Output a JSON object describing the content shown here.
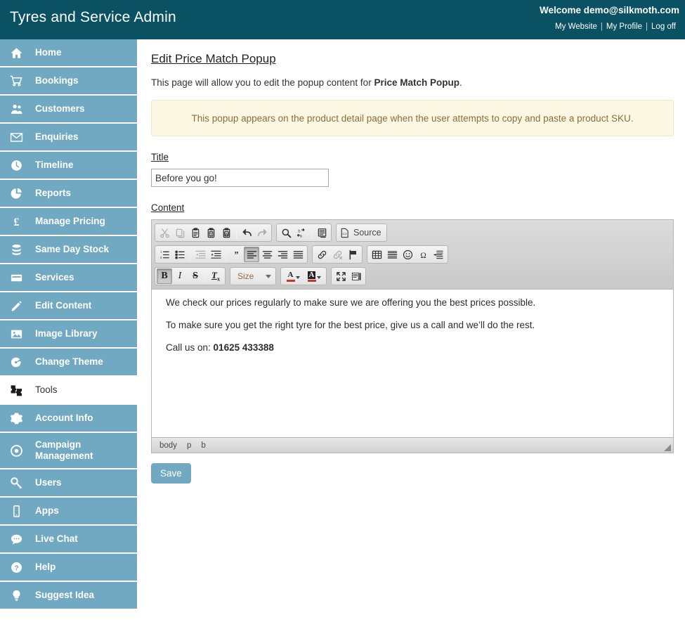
{
  "header": {
    "brand": "Tyres and Service Admin",
    "welcome": "Welcome demo@silkmoth.com",
    "links": [
      {
        "label": "My Website",
        "icon": "external-link-icon"
      },
      {
        "label": "My Profile",
        "icon": "user-icon"
      },
      {
        "label": "Log off",
        "icon": "logout-icon"
      }
    ],
    "separator": "|",
    "bg_color": "#0a5263"
  },
  "sidebar": {
    "bg_color": "#70a9c1",
    "active_item": "Tools",
    "items": [
      {
        "label": "Home",
        "icon": "home-icon",
        "active": false
      },
      {
        "label": "Bookings",
        "icon": "shopping-cart-icon",
        "active": false
      },
      {
        "label": "Customers",
        "icon": "users-icon",
        "active": false
      },
      {
        "label": "Enquiries",
        "icon": "envelope-icon",
        "active": false
      },
      {
        "label": "Timeline",
        "icon": "clock-icon",
        "active": false
      },
      {
        "label": "Reports",
        "icon": "pie-chart-icon",
        "active": false
      },
      {
        "label": "Manage Pricing",
        "icon": "pound-sterling-icon",
        "active": false
      },
      {
        "label": "Same Day Stock",
        "icon": "database-icon",
        "active": false
      },
      {
        "label": "Services",
        "icon": "credit-card-icon",
        "active": false
      },
      {
        "label": "Edit Content",
        "icon": "pencil-icon",
        "active": false
      },
      {
        "label": "Image Library",
        "icon": "image-icon",
        "active": false
      },
      {
        "label": "Change Theme",
        "icon": "paint-roller-icon",
        "active": false
      },
      {
        "label": "Tools",
        "icon": "puzzle-tools-icon",
        "active": true
      },
      {
        "label": "Account Info",
        "icon": "gear-icon",
        "active": false
      },
      {
        "label": "Campaign Management",
        "icon": "target-icon",
        "active": false
      },
      {
        "label": "Users",
        "icon": "key-icon",
        "active": false
      },
      {
        "label": "Apps",
        "icon": "mobile-icon",
        "active": false
      },
      {
        "label": "Live Chat",
        "icon": "chat-bubble-icon",
        "active": false
      },
      {
        "label": "Help",
        "icon": "question-circle-icon",
        "active": false
      },
      {
        "label": "Suggest Idea",
        "icon": "lightbulb-icon",
        "active": false
      }
    ]
  },
  "main": {
    "page_title": "Edit Price Match Popup",
    "intro_prefix": "This page will allow you to edit the popup content for ",
    "intro_bold": "Price Match Popup",
    "intro_suffix": ".",
    "notice": "This popup appears on the product detail page when the user attempts to copy and paste a product SKU.",
    "notice_bg_color": "#fcf8e3",
    "notice_text_color": "#8a6d3b",
    "title_label": "Title",
    "title_value": "Before you go!",
    "title_placeholder": "",
    "content_label": "Content",
    "save_label": "Save",
    "save_color": "#70a9c1"
  },
  "editor": {
    "toolbar_rows": [
      {
        "groups": [
          {
            "buttons": [
              {
                "name": "cut-icon",
                "title": "Cut",
                "disabled": true
              },
              {
                "name": "copy-icon",
                "title": "Copy",
                "disabled": true
              },
              {
                "name": "paste-icon",
                "title": "Paste",
                "disabled": false
              },
              {
                "name": "paste-as-text-icon",
                "title": "Paste as plain text",
                "disabled": false
              },
              {
                "name": "paste-from-word-icon",
                "title": "Paste from Word",
                "disabled": false
              },
              {
                "name": "separator",
                "title": "",
                "disabled": false
              },
              {
                "name": "undo-icon",
                "title": "Undo",
                "disabled": false
              },
              {
                "name": "redo-icon",
                "title": "Redo",
                "disabled": true
              }
            ]
          },
          {
            "buttons": [
              {
                "name": "find-icon",
                "title": "Find",
                "disabled": false
              },
              {
                "name": "replace-icon",
                "title": "Replace",
                "disabled": false
              },
              {
                "name": "separator",
                "title": "",
                "disabled": false
              },
              {
                "name": "select-all-icon",
                "title": "Select All",
                "disabled": false
              }
            ]
          }
        ],
        "source_button": {
          "name": "source-icon",
          "label": "Source"
        }
      },
      {
        "groups": [
          {
            "buttons": [
              {
                "name": "numbered-list-icon",
                "title": "Insert/Remove Numbered List",
                "disabled": false
              },
              {
                "name": "bulleted-list-icon",
                "title": "Insert/Remove Bulleted List",
                "disabled": false
              },
              {
                "name": "separator",
                "title": "",
                "disabled": false
              },
              {
                "name": "outdent-icon",
                "title": "Decrease Indent",
                "disabled": true
              },
              {
                "name": "indent-icon",
                "title": "Increase Indent",
                "disabled": false
              },
              {
                "name": "separator",
                "title": "",
                "disabled": false
              },
              {
                "name": "blockquote-icon",
                "title": "Block Quote",
                "disabled": false
              },
              {
                "name": "align-left-icon",
                "title": "Align Left",
                "disabled": false,
                "active": true
              },
              {
                "name": "align-center-icon",
                "title": "Center",
                "disabled": false
              },
              {
                "name": "align-right-icon",
                "title": "Align Right",
                "disabled": false
              },
              {
                "name": "align-justify-icon",
                "title": "Justify",
                "disabled": false
              }
            ]
          },
          {
            "buttons": [
              {
                "name": "link-icon",
                "title": "Link",
                "disabled": false
              },
              {
                "name": "unlink-icon",
                "title": "Unlink",
                "disabled": true
              },
              {
                "name": "anchor-flag-icon",
                "title": "Anchor",
                "disabled": false
              }
            ]
          },
          {
            "buttons": [
              {
                "name": "table-icon",
                "title": "Table",
                "disabled": false
              },
              {
                "name": "horizontal-rule-icon",
                "title": "Horizontal Line",
                "disabled": false
              },
              {
                "name": "smiley-icon",
                "title": "Smiley",
                "disabled": false
              },
              {
                "name": "special-char-icon",
                "title": "Insert Special Character",
                "disabled": false
              },
              {
                "name": "page-break-icon",
                "title": "Page Break",
                "disabled": false
              }
            ]
          }
        ]
      },
      {
        "groups": [
          {
            "buttons": [
              {
                "name": "bold-icon",
                "title": "Bold",
                "disabled": false,
                "active": true
              },
              {
                "name": "italic-icon",
                "title": "Italic",
                "disabled": false
              },
              {
                "name": "strikethrough-icon",
                "title": "Strikethrough",
                "disabled": false
              },
              {
                "name": "separator",
                "title": "",
                "disabled": false
              },
              {
                "name": "remove-format-icon",
                "title": "Remove Format",
                "disabled": false
              }
            ]
          },
          {
            "combo": {
              "name": "font-size-combo",
              "label": "Size"
            }
          },
          {
            "buttons": [
              {
                "name": "text-color-icon",
                "title": "Text Color",
                "disabled": false
              },
              {
                "name": "background-color-icon",
                "title": "Background Color",
                "disabled": false
              }
            ]
          },
          {
            "buttons": [
              {
                "name": "maximize-icon",
                "title": "Maximize",
                "disabled": false
              },
              {
                "name": "show-blocks-icon",
                "title": "Show Blocks",
                "disabled": false
              }
            ]
          }
        ]
      }
    ],
    "content_paragraphs": [
      {
        "text": "We check our prices regularly to make sure we are offering you the best prices possible.",
        "bold_tail": ""
      },
      {
        "text": "To make sure you get the right tyre for the best price, give us a call and we’ll do the rest.",
        "bold_tail": ""
      },
      {
        "text": "Call us on: ",
        "bold_tail": "01625 433388"
      }
    ],
    "element_path": [
      "body",
      "p",
      "b"
    ]
  }
}
